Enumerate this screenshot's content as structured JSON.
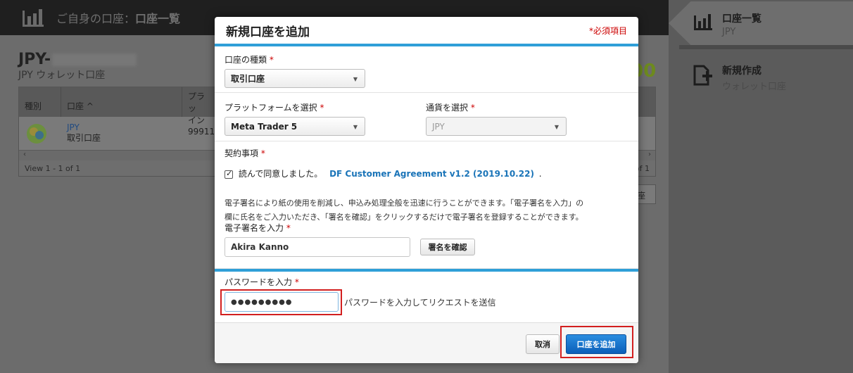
{
  "topbar": {
    "title_prefix": "ご自身の口座：",
    "title_main": "口座一覧"
  },
  "account": {
    "name": "JPY-",
    "subtitle": "JPY ウォレット口座",
    "balance_fragment": "00"
  },
  "grid": {
    "headers": [
      "種別",
      "口座 ^",
      "プラッ\nイン"
    ],
    "row": {
      "account_label": "JPY",
      "account_type": "取引口座",
      "number_fragment": "999110"
    },
    "footer_left": "View 1 - 1 of 1",
    "footer_right": "of 1",
    "partial_button": "座"
  },
  "right_panel": {
    "items": [
      {
        "title": "口座一覧",
        "subtitle": "JPY",
        "icon": "bar-chart-icon"
      },
      {
        "title": "新規作成",
        "subtitle": "ウォレット口座",
        "icon": "add-document-icon"
      }
    ]
  },
  "modal": {
    "title": "新規口座を追加",
    "required_note": "必須項目",
    "account_type": {
      "label": "口座の種類",
      "value": "取引口座"
    },
    "platform": {
      "label": "プラットフォームを選択",
      "value": "Meta Trader 5"
    },
    "currency": {
      "label": "通貨を選択",
      "value": "JPY"
    },
    "agreement": {
      "label": "契約事項",
      "checkbox_text": "読んで同意しました。",
      "link_text": "DF Customer Agreement v1.2 (2019.10.22)",
      "suffix": "."
    },
    "esign": {
      "description_line1": "電子署名により紙の使用を削減し、申込み処理全般を迅速に行うことができます。「電子署名を入力」の",
      "description_line2": "欄に氏名をご入力いただき、「署名を確認」をクリックするだけで電子署名を登録することができます。",
      "label": "電子署名を入力",
      "value": "Akira Kanno",
      "confirm_button": "署名を確認"
    },
    "password": {
      "label": "パスワードを入力",
      "value": "●●●●●●●●●",
      "hint": "パスワードを入力してリクエストを送信"
    },
    "cancel_button": "取消",
    "submit_button": "口座を追加"
  },
  "colors": {
    "accent_blue": "#2f9fd8",
    "primary_button": "#0b5fb9",
    "highlight_red": "#d21f1f",
    "required_red": "#cc0000",
    "link_blue": "#1a74b8"
  }
}
